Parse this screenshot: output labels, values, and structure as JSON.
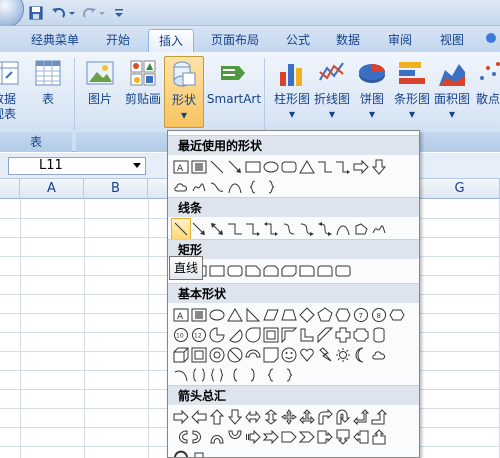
{
  "tabs": [
    "经典菜单",
    "开始",
    "插入",
    "页面布局",
    "公式",
    "数据",
    "审阅",
    "视图"
  ],
  "ribbon": {
    "left_buttons": [
      {
        "line1": "数据",
        "line2": "视表"
      },
      {
        "line1": "表",
        "line2": ""
      }
    ],
    "illus_buttons": [
      "图片",
      "剪贴画",
      "形状",
      "SmartArt"
    ],
    "chart_buttons": [
      "柱形图",
      "折线图",
      "饼图",
      "条形图",
      "面积图",
      "散点"
    ],
    "group_table": "表",
    "group_illus_partial": "插"
  },
  "formula": {
    "namebox": "L11"
  },
  "grid": {
    "columns": [
      "A",
      "B",
      "G"
    ]
  },
  "shapes_menu": {
    "recent_header": "最近使用的形状",
    "lines_header": "线条",
    "rect_header": "矩形",
    "basic_header": "基本形状",
    "arrows_header": "箭头总汇"
  },
  "tooltip": "直线",
  "colors": {
    "accent": "#15428b",
    "hover": "#ffd776",
    "ribbon_bg": "#dbe7f5"
  }
}
